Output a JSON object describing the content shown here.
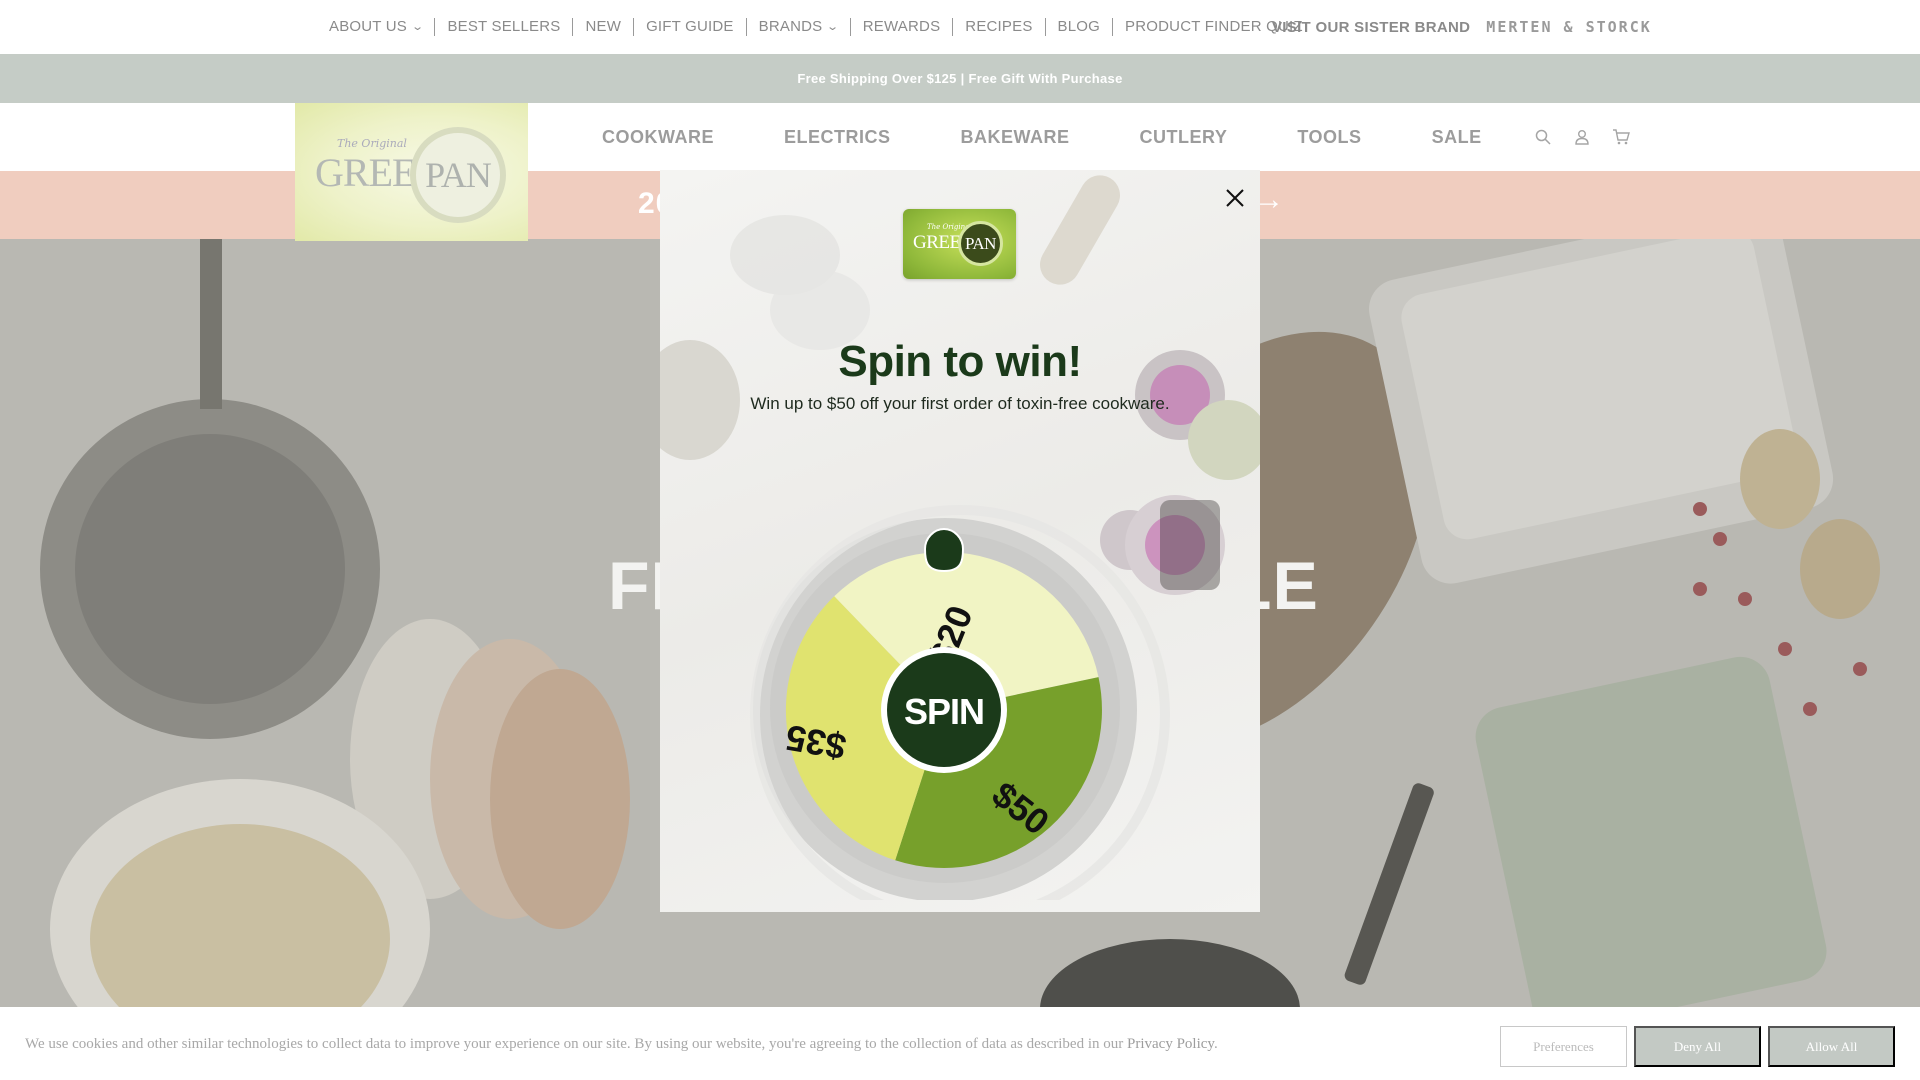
{
  "utility_nav": {
    "items": [
      {
        "label": "ABOUT US",
        "dropdown": true
      },
      {
        "label": "BEST SELLERS",
        "dropdown": false
      },
      {
        "label": "NEW",
        "dropdown": false
      },
      {
        "label": "GIFT GUIDE",
        "dropdown": false
      },
      {
        "label": "BRANDS",
        "dropdown": true
      },
      {
        "label": "REWARDS",
        "dropdown": false
      },
      {
        "label": "RECIPES",
        "dropdown": false
      },
      {
        "label": "BLOG",
        "dropdown": false
      },
      {
        "label": "PRODUCT FINDER QUIZ",
        "dropdown": false
      }
    ],
    "sister_label": "VISIT OUR SISTER BRAND",
    "sister_logo_text": "MERTEN & STORCK"
  },
  "promo_bar": {
    "text": "Free Shipping Over $125  |  Free Gift With Purchase"
  },
  "brand": {
    "logo_script": "The Original",
    "logo_green": "GREEN",
    "logo_pan": "PAN",
    "colors": {
      "primary": "#1b3a1a",
      "accent_lime": "#c7e05a",
      "accent_green": "#77a02b"
    }
  },
  "main_nav": {
    "items": [
      "COOKWARE",
      "ELECTRICS",
      "BAKEWARE",
      "CUTLERY",
      "TOOLS",
      "SALE"
    ],
    "icons": [
      "search-icon",
      "account-icon",
      "cart-icon"
    ]
  },
  "announcement": {
    "text_left": "20",
    "arrow": "→"
  },
  "hero": {
    "title_left": "FR",
    "title_right": "LE"
  },
  "modal": {
    "title": "Spin to win!",
    "subtitle": "Win up to $50 off your first order of toxin-free cookware.",
    "spin_label": "SPIN",
    "segments": [
      {
        "label": "$20",
        "color": "#f1f4c4"
      },
      {
        "label": "$50",
        "color": "#77a02b"
      },
      {
        "label": "$35",
        "color": "#e0e36f"
      }
    ]
  },
  "cookie": {
    "text": "We use cookies and other similar technologies to collect data to improve your experience on our site. By using our website, you're agreeing to the collection of data as described in our ",
    "link": "Privacy Policy",
    "period": ".",
    "buttons": {
      "preferences": "Preferences",
      "deny": "Deny All",
      "allow": "Allow All"
    }
  }
}
